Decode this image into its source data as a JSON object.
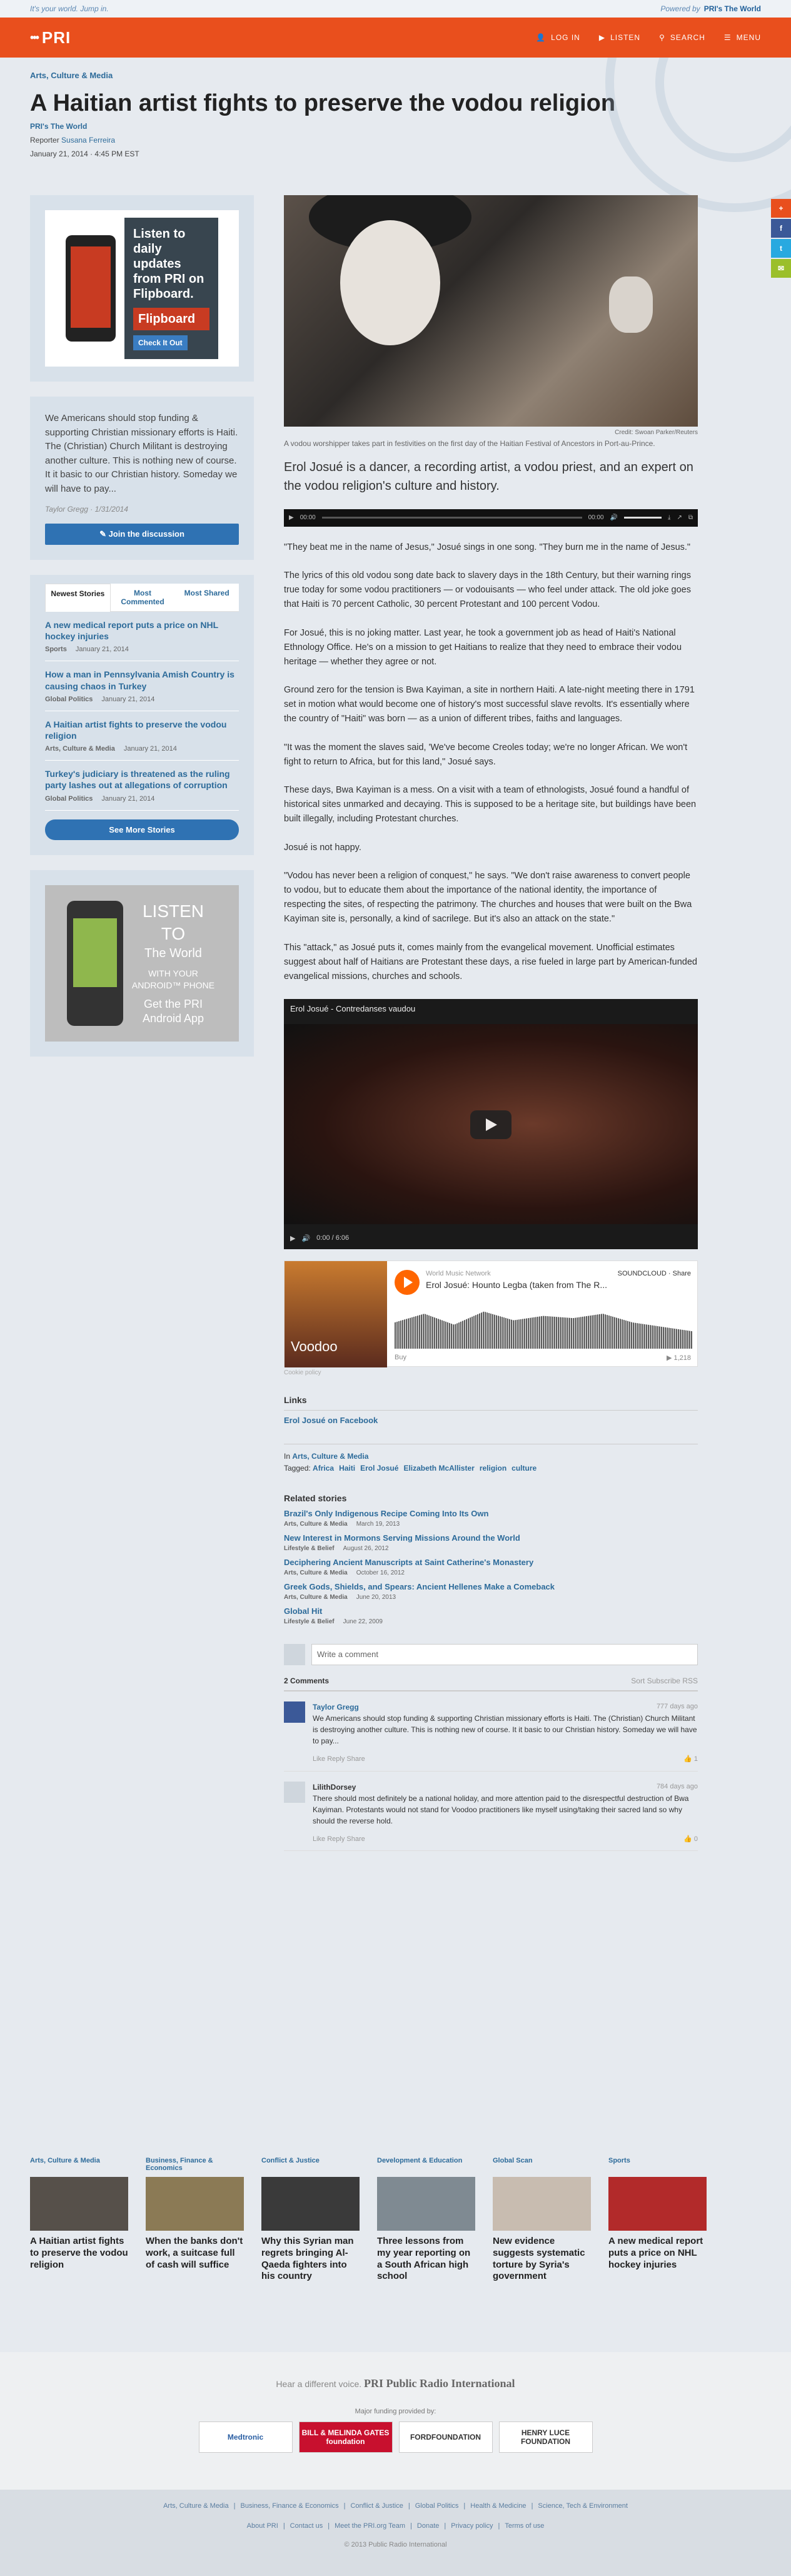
{
  "topstrip": {
    "slogan": "It's your world. Jump in.",
    "powered": "Powered by",
    "powered_brand": "PRI's The World"
  },
  "nav": {
    "logo": "PRI",
    "login": "LOG IN",
    "listen": "LISTEN",
    "search": "SEARCH",
    "menu": "MENU"
  },
  "header": {
    "category": "Arts, Culture & Media",
    "title": "A Haitian artist fights to preserve the vodou religion",
    "program": "PRI's The World",
    "reporter_label": "Reporter",
    "reporter": "Susana Ferreira",
    "date": "January 21, 2014 · 4:45 PM EST"
  },
  "sidebar": {
    "ad1": {
      "text": "Listen to daily updates from PRI on Flipboard.",
      "brand": "Flipboard",
      "cta": "Check It Out"
    },
    "comment": {
      "text": "We Americans should stop funding & supporting Christian missionary efforts is Haiti. The (Christian) Church Militant is destroying another culture. This is nothing new of course. It it basic to our Christian history. Someday we will have to pay...",
      "author": "Taylor Gregg · 1/31/2014",
      "button": "Join the discussion"
    },
    "tabs": [
      "Newest Stories",
      "Most Commented",
      "Most Shared"
    ],
    "stories": [
      {
        "title": "A new medical report puts a price on NHL hockey injuries",
        "cat": "Sports",
        "date": "January 21, 2014"
      },
      {
        "title": "How a man in Pennsylvania Amish Country is causing chaos in Turkey",
        "cat": "Global Politics",
        "date": "January 21, 2014"
      },
      {
        "title": "A Haitian artist fights to preserve the vodou religion",
        "cat": "Arts, Culture & Media",
        "date": "January 21, 2014"
      },
      {
        "title": "Turkey's judiciary is threatened as the ruling party lashes out at allegations of corruption",
        "cat": "Global Politics",
        "date": "January 21, 2014"
      }
    ],
    "see_more": "See More Stories",
    "ad2": {
      "big": "LISTEN TO",
      "brand": "The World",
      "line1": "WITH YOUR ANDROID™ PHONE",
      "line2": "Get the PRI Android App"
    }
  },
  "article": {
    "credit": "Credit: Swoan Parker/Reuters",
    "caption": "A vodou worshipper takes part in festivities on the first day of the Haitian Festival of Ancestors in Port-au-Prince.",
    "lede": "Erol Josué is a dancer, a recording artist, a vodou priest, and an expert on the vodou religion's culture and history.",
    "audio_time": "00:00",
    "audio_total": "00:00",
    "paragraphs": [
      "\"They beat me in the name of Jesus,\" Josué sings in one song. \"They burn me in the name of Jesus.\"",
      "The lyrics of this old vodou song date back to slavery days in the 18th Century, but their warning rings true today for some vodou practitioners — or vodouisants — who feel under attack. The old joke goes that Haiti is 70 percent Catholic, 30 percent Protestant and 100 percent Vodou.",
      "For Josué, this is no joking matter. Last year, he took a government job as head of Haiti's National Ethnology Office. He's on a mission to get Haitians to realize that they need to embrace their vodou heritage — whether they agree or not.",
      "Ground zero for the tension is Bwa Kayiman, a site in northern Haiti. A late-night meeting there in 1791 set in motion what would become one of history's most successful slave revolts. It's essentially where the country of \"Haiti\" was born — as a union of different tribes, faiths and languages.",
      "\"It was the moment the slaves said, 'We've become Creoles today; we're no longer African. We won't fight to return to Africa, but for this land,\" Josué says.",
      "These days, Bwa Kayiman is a mess. On a visit with a team of ethnologists, Josué found a handful of historical sites unmarked and decaying. This is supposed to be a heritage site, but buildings have been built illegally, including Protestant churches.",
      "Josué is not happy.",
      "\"Vodou has never been a religion of conquest,\" he says. \"We don't raise awareness to convert people to vodou, but to educate them about the importance of the national identity, the importance of respecting the sites, of respecting the patrimony. The churches and houses that were built on the Bwa Kayiman site is, personally, a kind of sacrilege. But it's also an attack on the state.\"",
      "This \"attack,\" as Josué puts it, comes mainly from the evangelical movement. Unofficial estimates suggest about half of Haitians are Protestant these days, a rise fueled in large part by American-funded evangelical missions, churches and schools."
    ],
    "video": {
      "title": "Erol Josué - Contredanses vaudou",
      "time": "0:00 / 6:06"
    },
    "soundcloud": {
      "user": "World Music Network",
      "track": "Erol Josué: Hounto Legba (taken from The R...",
      "art": "Voodoo",
      "share": "Share",
      "buy": "Buy",
      "plays": "1,218",
      "cookie": "Cookie policy",
      "brand": "SOUNDCLOUD"
    },
    "links_title": "Links",
    "links": [
      "Erol Josué on Facebook"
    ],
    "in_label": "In",
    "in_cat": "Arts, Culture & Media",
    "tagged_label": "Tagged:",
    "tags": [
      "Africa",
      "Haiti",
      "Erol Josué",
      "Elizabeth McAllister",
      "religion",
      "culture"
    ],
    "related_title": "Related stories",
    "related": [
      {
        "title": "Brazil's Only Indigenous Recipe Coming Into Its Own",
        "cat": "Arts, Culture & Media",
        "date": "March 19, 2013"
      },
      {
        "title": "New Interest in Mormons Serving Missions Around the World",
        "cat": "Lifestyle & Belief",
        "date": "August 26, 2012"
      },
      {
        "title": "Deciphering Ancient Manuscripts at Saint Catherine's Monastery",
        "cat": "Arts, Culture & Media",
        "date": "October 16, 2012"
      },
      {
        "title": "Greek Gods, Shields, and Spears: Ancient Hellenes Make a Comeback",
        "cat": "Arts, Culture & Media",
        "date": "June 20, 2013"
      },
      {
        "title": "Global Hit",
        "cat": "Lifestyle & Belief",
        "date": "June 22, 2009"
      }
    ],
    "comments": {
      "placeholder": "Write a comment",
      "count": "2 Comments",
      "sort": "Sort  Subscribe  RSS",
      "items": [
        {
          "author": "Taylor Gregg",
          "ago": "777 days ago",
          "text": "We Americans should stop funding & supporting Christian missionary efforts is Haiti. The (Christian) Church Militant is destroying another culture. This is nothing new of course. It it basic to our Christian history. Someday we will have to pay...",
          "actions": "Like  Reply  Share",
          "likes": "1"
        },
        {
          "author": "LilithDorsey",
          "ago": "784 days ago",
          "text": "There should most definitely be a national holiday, and more attention paid to the disrespectful destruction of Bwa Kayiman. Protestants would not stand for Voodoo practitioners like myself using/taking their sacred land so why should the reverse hold.",
          "actions": "Like  Reply  Share",
          "likes": "0"
        }
      ]
    }
  },
  "social": [
    "+",
    "f",
    "t",
    "✉"
  ],
  "bottom_stories": [
    {
      "cat": "Arts, Culture & Media",
      "title": "A Haitian artist fights to preserve the vodou religion"
    },
    {
      "cat": "Business, Finance & Economics",
      "title": "When the banks don't work, a suitcase full of cash will suffice"
    },
    {
      "cat": "Conflict & Justice",
      "title": "Why this Syrian man regrets bringing Al-Qaeda fighters into his country"
    },
    {
      "cat": "Development & Education",
      "title": "Three lessons from my year reporting on a South African high school"
    },
    {
      "cat": "Global Scan",
      "title": "New evidence suggests systematic torture by Syria's government"
    },
    {
      "cat": "Sports",
      "title": "A new medical report puts a price on NHL hockey injuries"
    }
  ],
  "footer": {
    "tagline": "Hear a different voice.",
    "brand": "PRI Public Radio International",
    "funding": "Major funding provided by:",
    "funders": [
      "Medtronic",
      "BILL & MELINDA GATES foundation",
      "FORDFOUNDATION",
      "HENRY LUCE FOUNDATION"
    ],
    "links1": [
      "Arts, Culture & Media",
      "Business, Finance & Economics",
      "Conflict & Justice",
      "Global Politics",
      "Health & Medicine",
      "Science, Tech & Environment"
    ],
    "links2": [
      "About PRI",
      "Contact us",
      "Meet the PRI.org Team",
      "Donate",
      "Privacy policy",
      "Terms of use"
    ],
    "copyright": "© 2013 Public Radio International"
  },
  "colors": {
    "brand": "#e94f1d",
    "link": "#2d6b9a",
    "button": "#2f72b3"
  }
}
